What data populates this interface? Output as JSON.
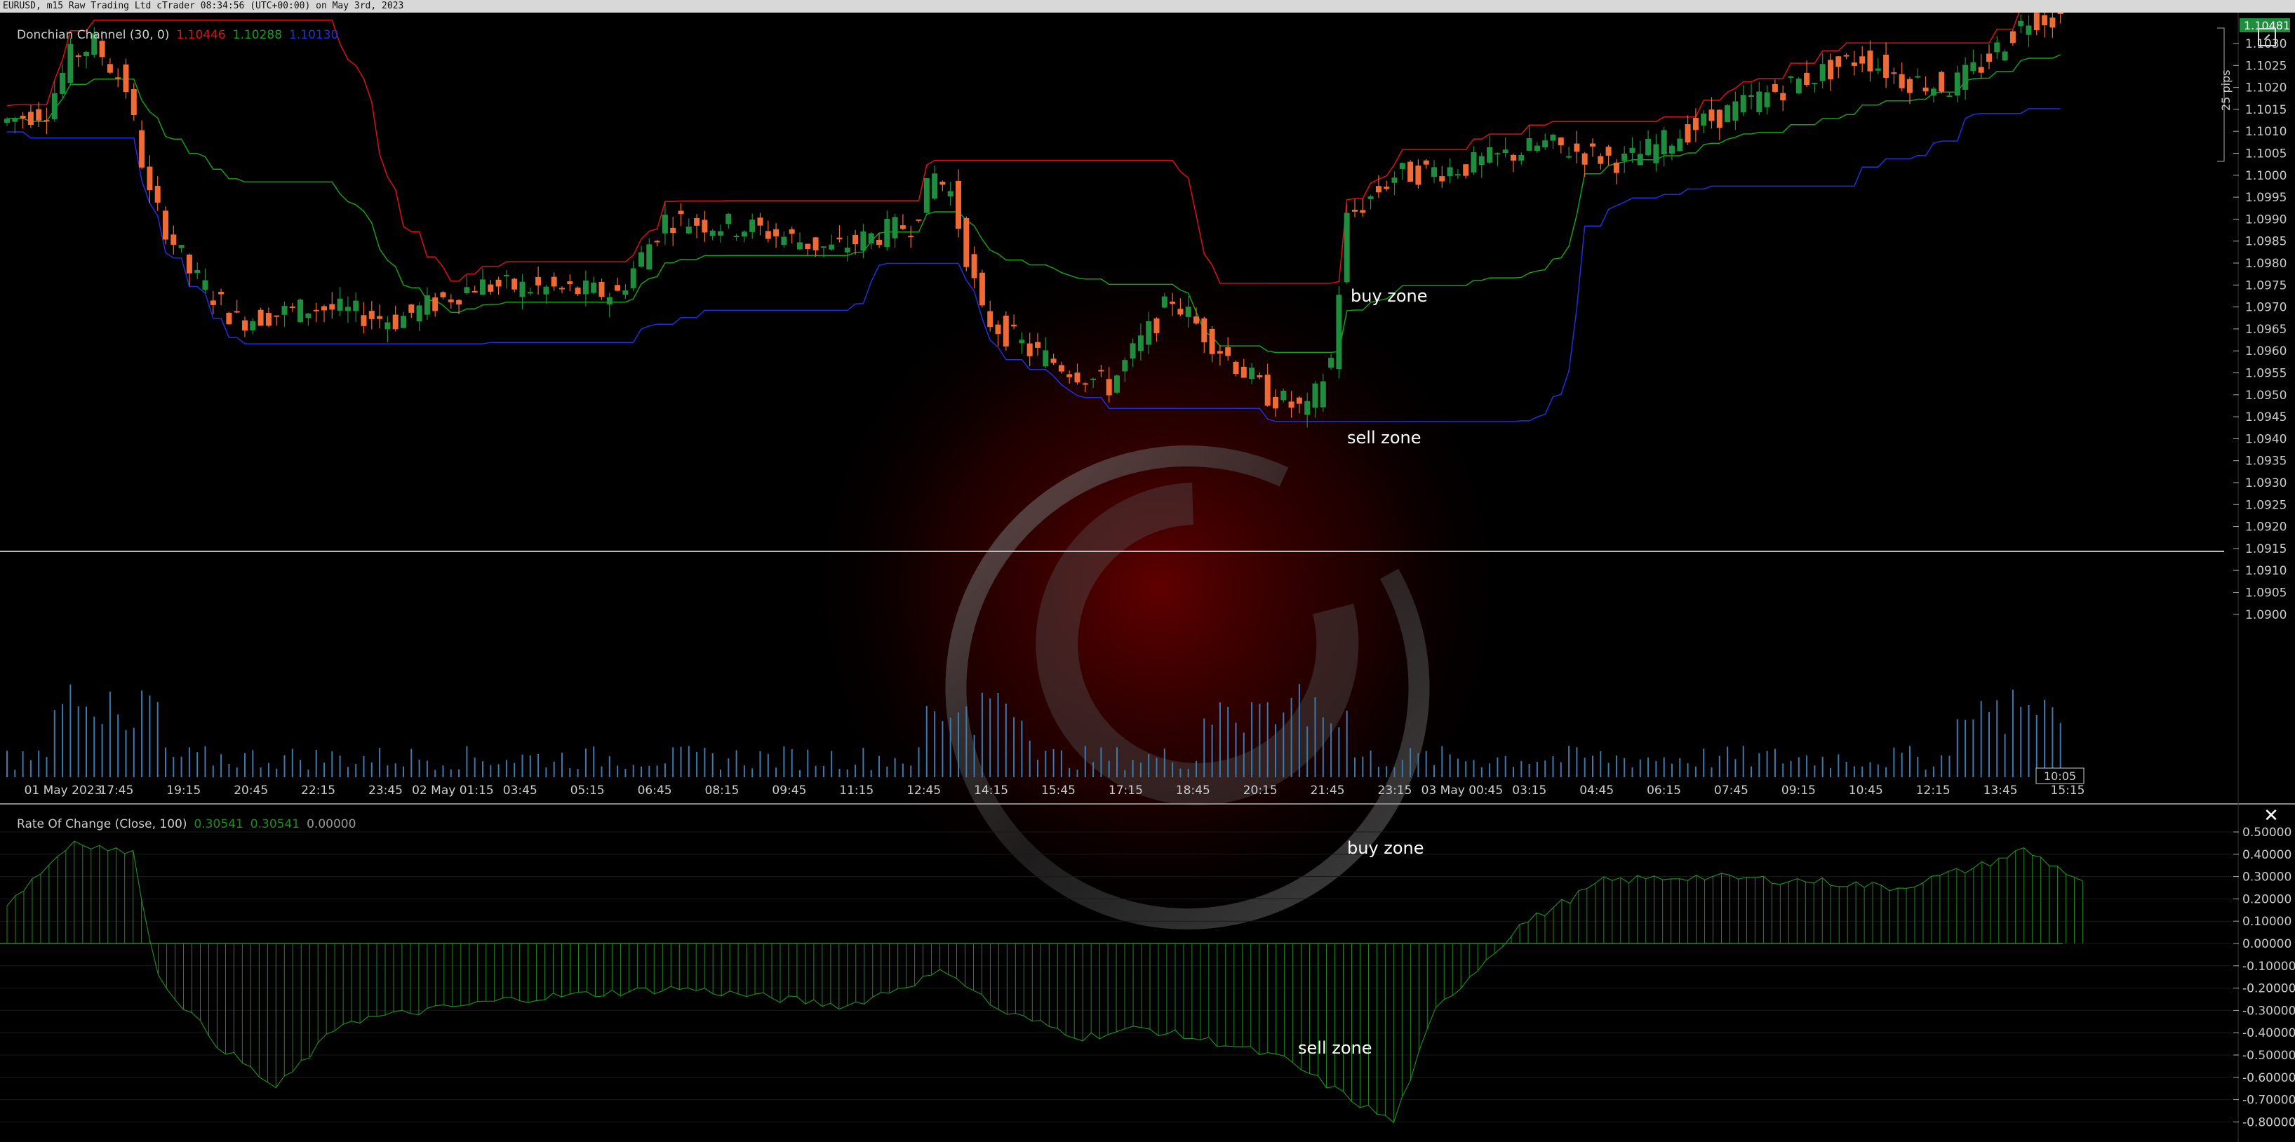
{
  "window_title": "EURUSD, m15 Raw Trading Ltd cTrader 08:34:56 (UTC+00:00) on May 3rd, 2023",
  "indicators": {
    "donchian": {
      "label": "Donchian Channel (30, 0)",
      "upper": "1.10446",
      "middle": "1.10288",
      "lower": "1.10130",
      "upper_color": "#e01010",
      "middle_color": "#16a016",
      "lower_color": "#2030e0"
    },
    "roc": {
      "label": "Rate Of Change (Close, 100)",
      "v1": "0.30541",
      "v2": "0.30541",
      "v3": "0.00000",
      "color": "#1f8a1f"
    }
  },
  "annotations": {
    "buy_zone_top": "buy zone",
    "sell_zone_top": "sell zone",
    "buy_zone_bottom": "buy zone",
    "sell_zone_bottom": "sell zone"
  },
  "price_axis": {
    "labels": [
      "1.1030",
      "1.1025",
      "1.1020",
      "1.1015",
      "1.1010",
      "1.1005",
      "1.1000",
      "1.0995",
      "1.0990",
      "1.0985",
      "1.0980",
      "1.0975",
      "1.0970",
      "1.0965",
      "1.0960",
      "1.0955",
      "1.0950",
      "1.0945",
      "1.0940",
      "1.0935",
      "1.0930",
      "1.0925",
      "1.0920",
      "1.0915",
      "1.0910",
      "1.0905",
      "1.0900"
    ],
    "pips_label": "25 pips",
    "current_price_label": "1.10481"
  },
  "time_axis": {
    "labels": [
      "01 May 2023",
      "17:45",
      "19:15",
      "20:45",
      "22:15",
      "23:45",
      "02 May 01:15",
      "03:45",
      "05:15",
      "06:45",
      "08:15",
      "09:45",
      "11:15",
      "12:45",
      "14:15",
      "15:45",
      "17:15",
      "18:45",
      "20:15",
      "21:45",
      "23:15",
      "03 May 00:45",
      "03:15",
      "04:45",
      "06:15",
      "07:45",
      "09:15",
      "10:45",
      "12:15",
      "13:45",
      "15:15"
    ],
    "current_time_label": "10:05"
  },
  "roc_axis": {
    "labels": [
      "0.50000",
      "0.40000",
      "0.30000",
      "0.20000",
      "0.10000",
      "0.00000",
      "-0.10000",
      "-0.20000",
      "-0.30000",
      "-0.40000",
      "-0.50000",
      "-0.60000",
      "-0.70000",
      "-0.80000"
    ]
  },
  "colors": {
    "bull": "#1e8e3e",
    "bear": "#f06a35",
    "volume": "#3a7ab0",
    "background": "#000000"
  },
  "icons": {
    "close": "close-icon",
    "panel": "collapse-panel-icon"
  },
  "close_symbol": "✕"
}
